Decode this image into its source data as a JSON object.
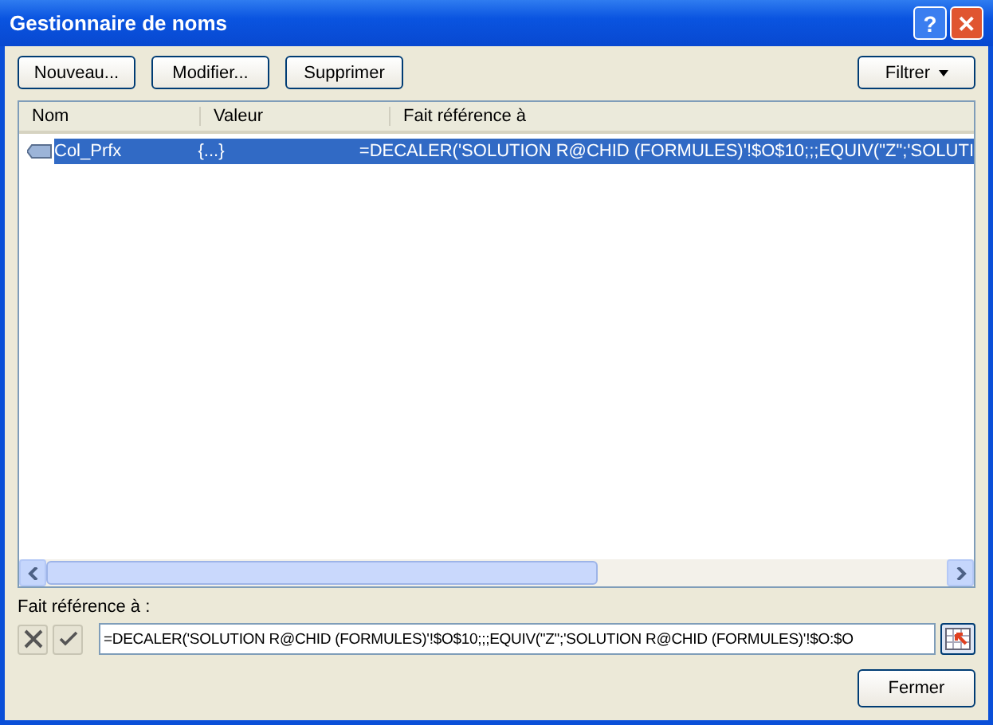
{
  "window": {
    "title": "Gestionnaire de noms",
    "controls": [
      "?",
      "✕"
    ]
  },
  "toolbar": {
    "buttons": [
      "Nouveau...",
      "Modifier...",
      "Supprimer"
    ],
    "filter": "Filtrer"
  },
  "table": {
    "columns": [
      "Nom",
      "Valeur",
      "Fait référence à"
    ],
    "rows": [
      {
        "name": "Col_Prfx",
        "value": "{...}",
        "refers_to": "=DECALER('SOLUTION R@CHID (FORMULES)'!$O$10;;;EQUIV(\"Z\";'SOLUTI",
        "selected": true
      }
    ]
  },
  "refers_to": {
    "label": "Fait référence à :",
    "value": "=DECALER('SOLUTION R@CHID (FORMULES)'!$O$10;;;EQUIV(\"Z\";'SOLUTION R@CHID (FORMULES)'!$O:$O"
  },
  "close_button": "Fermer"
}
